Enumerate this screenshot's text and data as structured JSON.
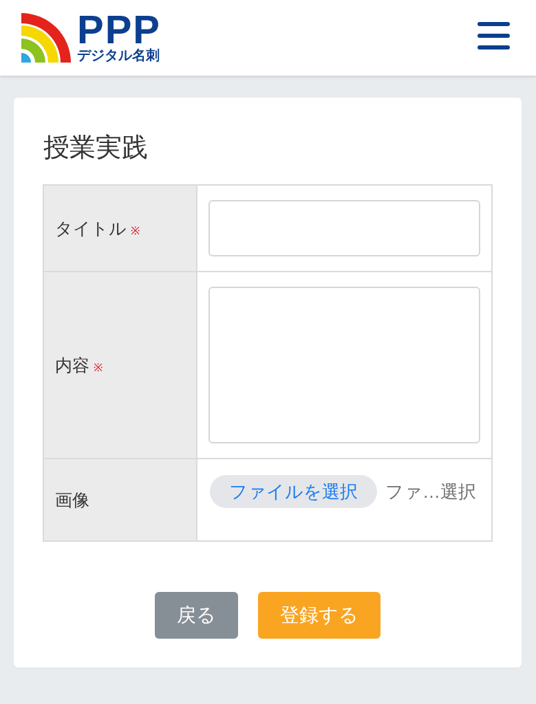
{
  "header": {
    "logo": {
      "wordmark": "PPP",
      "tagline": "デジタル名刺"
    }
  },
  "form": {
    "title": "授業実践",
    "fields": [
      {
        "kind": "text",
        "label": "タイトル",
        "required_mark": "※"
      },
      {
        "kind": "textarea",
        "label": "内容",
        "required_mark": "※"
      },
      {
        "kind": "file",
        "label": "画像",
        "button": "ファイルを選択",
        "file_status": "ファ…選択"
      }
    ]
  },
  "buttons": [
    {
      "kind": "back",
      "label": "戻る"
    },
    {
      "kind": "submit",
      "label": "登録する"
    }
  ]
}
